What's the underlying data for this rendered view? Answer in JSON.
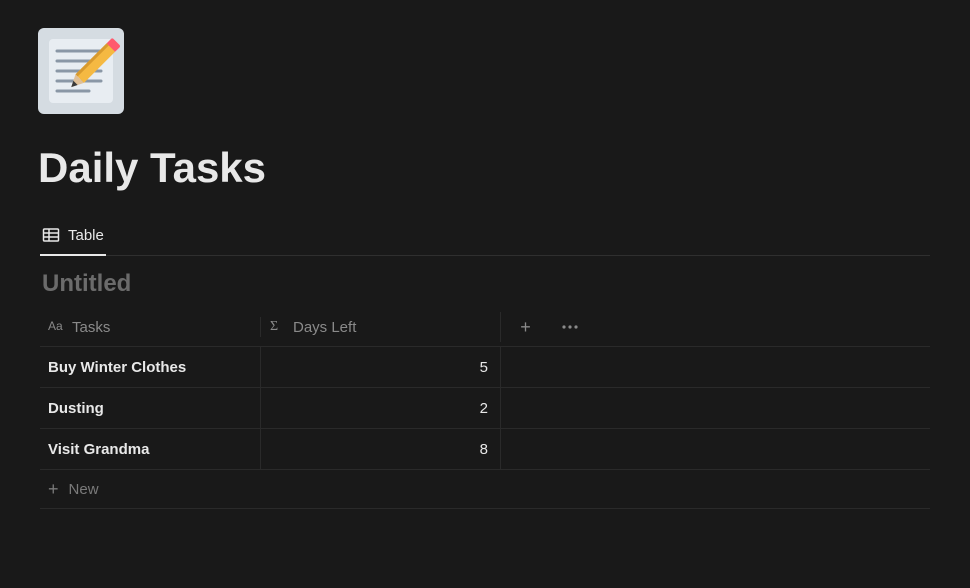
{
  "page": {
    "title": "Daily Tasks",
    "icon_name": "memo-pencil-icon"
  },
  "tabs": [
    {
      "label": "Table",
      "active": true
    }
  ],
  "view": {
    "title": "Untitled"
  },
  "columns": {
    "tasks": {
      "label": "Tasks",
      "icon": "text-icon"
    },
    "days_left": {
      "label": "Days Left",
      "icon": "formula-icon"
    }
  },
  "rows": [
    {
      "tasks": "Buy Winter Clothes",
      "days_left": "5"
    },
    {
      "tasks": "Dusting",
      "days_left": "2"
    },
    {
      "tasks": "Visit Grandma",
      "days_left": "8"
    }
  ],
  "actions": {
    "new_row": "New"
  }
}
